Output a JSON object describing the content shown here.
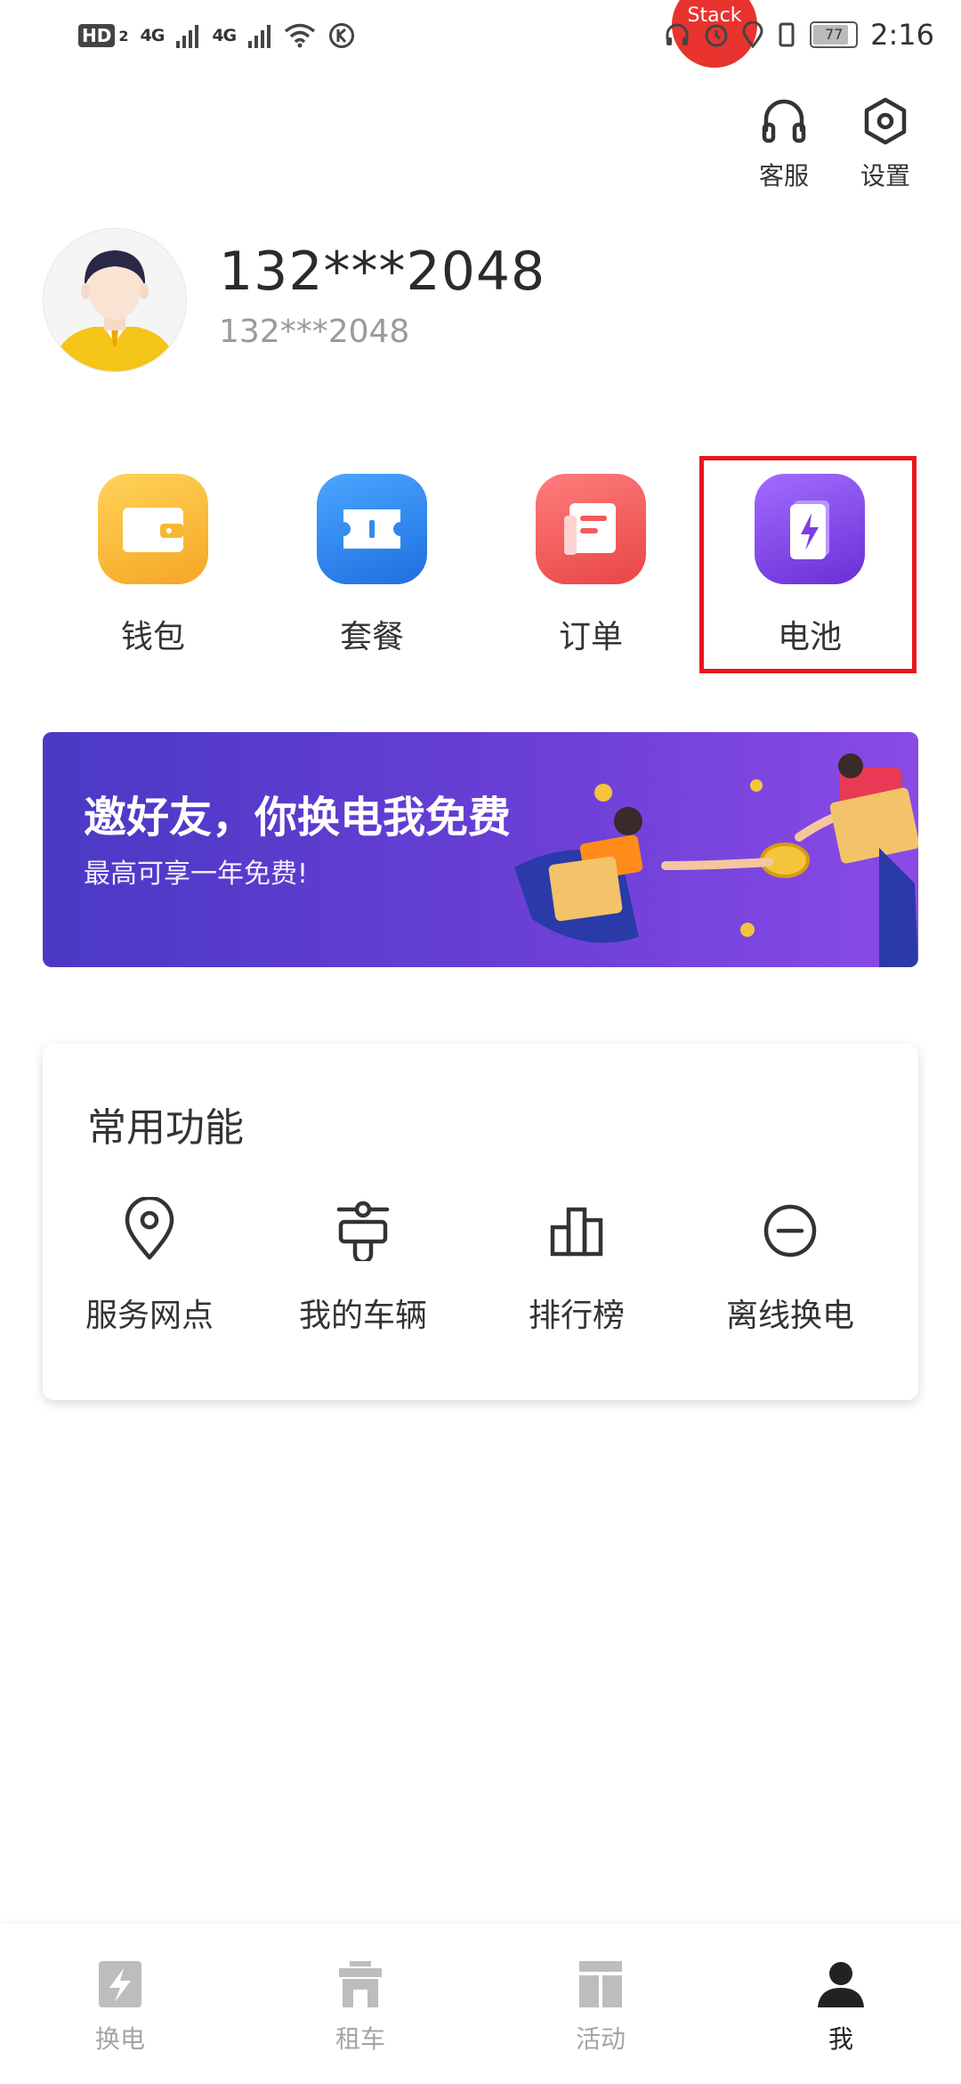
{
  "status_bar": {
    "hd": "HD",
    "hd_sub": "2",
    "signal1": "4G",
    "signal2": "4G",
    "battery": "77",
    "time": "2:16",
    "bubble": "Stack"
  },
  "header": {
    "service_label": "客服",
    "settings_label": "设置"
  },
  "profile": {
    "name": "132***2048",
    "phone": "132***2048"
  },
  "quick_actions": [
    {
      "label": "钱包",
      "icon": "wallet-icon",
      "color": "#f7b733"
    },
    {
      "label": "套餐",
      "icon": "ticket-icon",
      "color": "#2f8df5"
    },
    {
      "label": "订单",
      "icon": "order-icon",
      "color": "#f25a5a"
    },
    {
      "label": "电池",
      "icon": "battery-icon",
      "color": "#7b3fe4"
    }
  ],
  "banner": {
    "title": "邀好友，你换电我免费",
    "subtitle": "最高可享一年免费!"
  },
  "common_functions": {
    "title": "常用功能",
    "items": [
      {
        "label": "服务网点",
        "icon": "location-pin-icon"
      },
      {
        "label": "我的车辆",
        "icon": "vehicle-icon"
      },
      {
        "label": "排行榜",
        "icon": "ranking-icon"
      },
      {
        "label": "离线换电",
        "icon": "offline-swap-icon"
      }
    ]
  },
  "tabbar": {
    "items": [
      {
        "label": "换电",
        "icon": "swap-battery-icon",
        "active": false
      },
      {
        "label": "租车",
        "icon": "rent-car-icon",
        "active": false
      },
      {
        "label": "活动",
        "icon": "activity-icon",
        "active": false
      },
      {
        "label": "我",
        "icon": "profile-icon",
        "active": true
      }
    ]
  },
  "colors": {
    "highlight": "#e8151f",
    "inactive_tab": "#a5a5a5",
    "active_tab": "#222222"
  }
}
